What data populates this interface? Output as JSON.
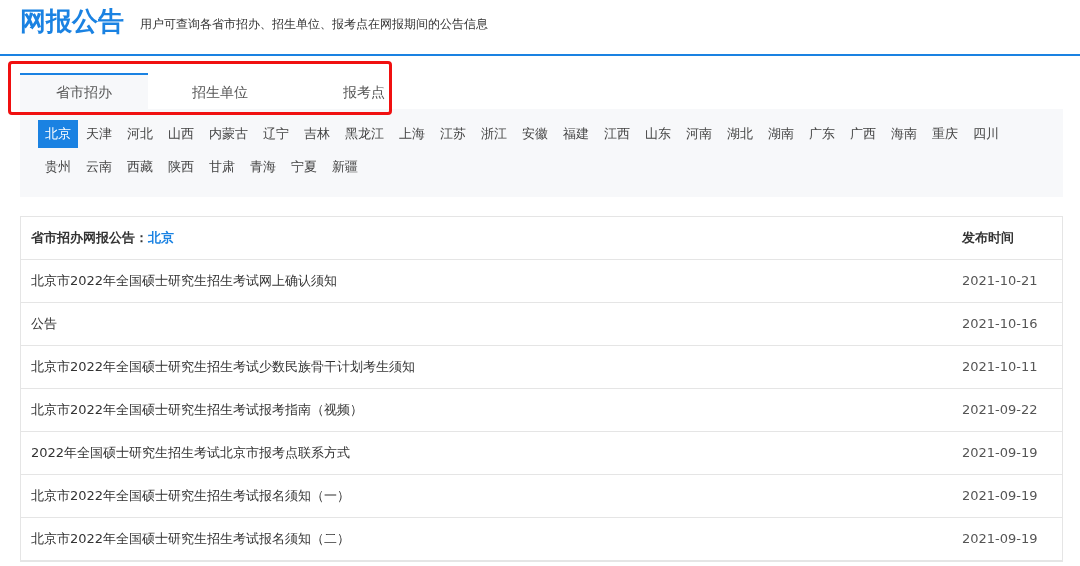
{
  "header": {
    "title": "网报公告",
    "subtitle": "用户可查询各省市招办、招生单位、报考点在网报期间的公告信息"
  },
  "tabs": [
    {
      "label": "省市招办",
      "selected": true
    },
    {
      "label": "招生单位",
      "selected": false
    },
    {
      "label": "报考点",
      "selected": false
    }
  ],
  "highlight": {
    "on": true
  },
  "provinces": [
    {
      "label": "北京",
      "selected": true
    },
    {
      "label": "天津",
      "selected": false
    },
    {
      "label": "河北",
      "selected": false
    },
    {
      "label": "山西",
      "selected": false
    },
    {
      "label": "内蒙古",
      "selected": false
    },
    {
      "label": "辽宁",
      "selected": false
    },
    {
      "label": "吉林",
      "selected": false
    },
    {
      "label": "黑龙江",
      "selected": false
    },
    {
      "label": "上海",
      "selected": false
    },
    {
      "label": "江苏",
      "selected": false
    },
    {
      "label": "浙江",
      "selected": false
    },
    {
      "label": "安徽",
      "selected": false
    },
    {
      "label": "福建",
      "selected": false
    },
    {
      "label": "江西",
      "selected": false
    },
    {
      "label": "山东",
      "selected": false
    },
    {
      "label": "河南",
      "selected": false
    },
    {
      "label": "湖北",
      "selected": false
    },
    {
      "label": "湖南",
      "selected": false
    },
    {
      "label": "广东",
      "selected": false
    },
    {
      "label": "广西",
      "selected": false
    },
    {
      "label": "海南",
      "selected": false
    },
    {
      "label": "重庆",
      "selected": false
    },
    {
      "label": "四川",
      "selected": false
    },
    {
      "label": "贵州",
      "selected": false
    },
    {
      "label": "云南",
      "selected": false
    },
    {
      "label": "西藏",
      "selected": false
    },
    {
      "label": "陕西",
      "selected": false
    },
    {
      "label": "甘肃",
      "selected": false
    },
    {
      "label": "青海",
      "selected": false
    },
    {
      "label": "宁夏",
      "selected": false
    },
    {
      "label": "新疆",
      "selected": false
    }
  ],
  "table": {
    "heading": "省市招办网报公告：",
    "region": "北京",
    "date_column": "发布时间",
    "rows": [
      {
        "title": "北京市2022年全国硕士研究生招生考试网上确认须知",
        "date": "2021-10-21"
      },
      {
        "title": "公告",
        "date": "2021-10-16"
      },
      {
        "title": "北京市2022年全国硕士研究生招生考试少数民族骨干计划考生须知",
        "date": "2021-10-11"
      },
      {
        "title": "北京市2022年全国硕士研究生招生考试报考指南（视频）",
        "date": "2021-09-22"
      },
      {
        "title": "2022年全国硕士研究生招生考试北京市报考点联系方式",
        "date": "2021-09-19"
      },
      {
        "title": "北京市2022年全国硕士研究生招生考试报名须知（一）",
        "date": "2021-09-19"
      },
      {
        "title": "北京市2022年全国硕士研究生招生考试报名须知（二）",
        "date": "2021-09-19"
      }
    ]
  }
}
